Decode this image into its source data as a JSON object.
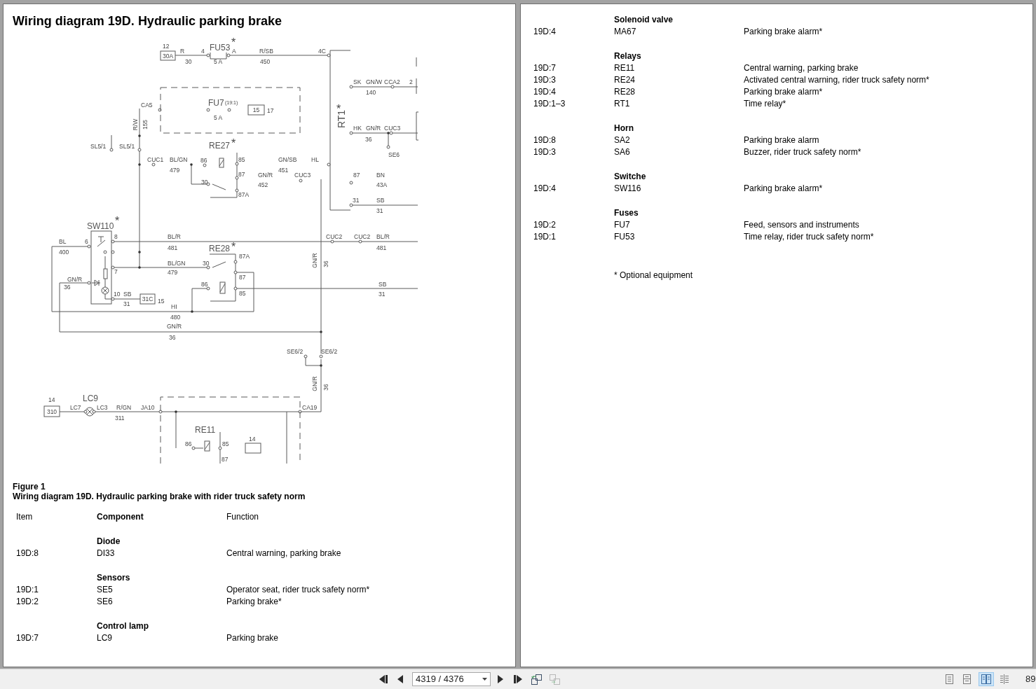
{
  "left_page": {
    "title": "Wiring diagram 19D. Hydraulic parking brake",
    "diagram": {
      "labels": [
        "12",
        "R",
        "4",
        "FU53",
        "*",
        "A",
        "R/SB",
        "4C",
        "30",
        "5 A",
        "450",
        "CA5",
        "FU7",
        "(19:1)",
        "17",
        "5 A",
        "SL5/1",
        "SL5/1",
        "RE27",
        "*",
        "CUC1",
        "BL/GN",
        "86",
        "85",
        "GN/SB",
        "HL",
        "479",
        "87",
        "GN/R",
        "451",
        "CUC3",
        "30",
        "452",
        "87A",
        "SK",
        "GN/W",
        "CCA2",
        "2",
        "140",
        "*",
        "HK",
        "GN/R",
        "CUC3",
        "36",
        "SE6",
        "87",
        "BN",
        "43A",
        "31",
        "SB",
        "31",
        "SW110",
        "*",
        "BL",
        "6",
        "8",
        "BL/R",
        "CUC2",
        "CUC2",
        "BL/R",
        "400",
        "481",
        "RE28",
        "*",
        "481",
        "87A",
        "BL/GN",
        "30",
        "7",
        "479",
        "GN/R",
        "87",
        "36",
        "86",
        "SB",
        "10",
        "SB",
        "85",
        "31",
        "31",
        "15",
        "HI",
        "480",
        "GN/R",
        "36",
        "SE6/2",
        "SE6/2",
        "14",
        "LC7",
        "LC9",
        "LC3",
        "R/GN",
        "311",
        "JA10",
        "CA19",
        "RE11",
        "86",
        "85",
        "14",
        "87"
      ],
      "vertical_labels": [
        "R/W",
        "155",
        "RT1",
        "GN/R",
        "36",
        "GN/R",
        "36"
      ],
      "boxed_labels": [
        "30A",
        "15",
        "31C",
        "310"
      ]
    },
    "figure_label": "Figure 1",
    "caption": "Wiring diagram 19D. Hydraulic parking brake with rider truck safety norm",
    "table": {
      "columns": [
        "Item",
        "Component",
        "Function"
      ],
      "groups": [
        {
          "heading": "Diode",
          "rows": [
            [
              "19D:8",
              "DI33",
              "Central warning, parking brake"
            ]
          ]
        },
        {
          "heading": "Sensors",
          "rows": [
            [
              "19D:1",
              "SE5",
              "Operator seat, rider truck safety norm*"
            ],
            [
              "19D:2",
              "SE6",
              "Parking brake*"
            ]
          ]
        },
        {
          "heading": "Control lamp",
          "rows": [
            [
              "19D:7",
              "LC9",
              "Parking brake"
            ]
          ]
        }
      ]
    }
  },
  "right_page": {
    "groups": [
      {
        "heading": "Solenoid valve",
        "rows": [
          [
            "19D:4",
            "MA67",
            "Parking brake alarm*"
          ]
        ]
      },
      {
        "heading": "Relays",
        "rows": [
          [
            "19D:7",
            "RE11",
            "Central warning, parking brake"
          ],
          [
            "19D:3",
            "RE24",
            "Activated central warning, rider truck safety norm*"
          ],
          [
            "19D:4",
            "RE28",
            "Parking brake alarm*"
          ],
          [
            "19D:1–3",
            "RT1",
            "Time relay*"
          ]
        ]
      },
      {
        "heading": "Horn",
        "rows": [
          [
            "19D:8",
            "SA2",
            "Parking brake alarm"
          ],
          [
            "19D:3",
            "SA6",
            "Buzzer, rider truck safety norm*"
          ]
        ]
      },
      {
        "heading": "Switche",
        "rows": [
          [
            "19D:4",
            "SW116",
            "Parking brake alarm*"
          ]
        ]
      },
      {
        "heading": "Fuses",
        "rows": [
          [
            "19D:2",
            "FU7",
            "Feed, sensors and instruments"
          ],
          [
            "19D:1",
            "FU53",
            "Time relay, rider truck safety norm*"
          ]
        ]
      }
    ],
    "footnote": "* Optional equipment"
  },
  "toolbar": {
    "page_field": {
      "value": "4319 / 4376"
    },
    "tools": [
      {
        "kind": "sync-left",
        "disabled": false
      },
      {
        "kind": "sync-right",
        "disabled": true
      }
    ],
    "view_modes": [
      {
        "kind": "single",
        "selected": false
      },
      {
        "kind": "continuous",
        "selected": false
      },
      {
        "kind": "facing",
        "selected": true
      },
      {
        "kind": "facing-continuous",
        "selected": false
      }
    ],
    "zoom": "89"
  }
}
